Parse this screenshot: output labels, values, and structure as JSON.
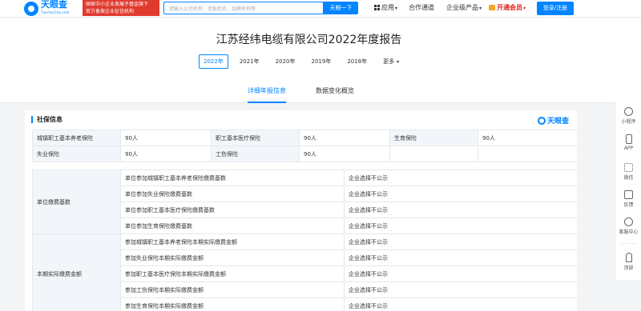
{
  "topbar": {
    "logo_text": "天眼查",
    "logo_sub": "TianYanCha.com",
    "promo_line1": "国家中小企业发展子基金旗下",
    "promo_line2": "官方备案企业征信机构",
    "search_placeholder": "请输入公司名称、老板姓名、品牌名称等",
    "search_button": "天眼一下",
    "nav_app": "应用",
    "nav_coop": "合作通道",
    "nav_products": "企业级产品",
    "nav_vip": "开通会员",
    "login_button": "登录/注册"
  },
  "header": {
    "title": "江苏经纬电缆有限公司2022年度报告",
    "years": [
      "2022年",
      "2021年",
      "2020年",
      "2019年",
      "2018年",
      "更多"
    ],
    "tabs": [
      "详细年报信息",
      "数据变化概览"
    ]
  },
  "section": {
    "title": "社保信息",
    "watermark": "天眼查"
  },
  "insurance": {
    "row1": [
      "城镇职工基本养老保险",
      "90人",
      "职工基本医疗保险",
      "90人",
      "生育保险",
      "90人"
    ],
    "row2": [
      "失业保险",
      "90人",
      "工伤保险",
      "90人"
    ]
  },
  "payment_base": {
    "label": "单位缴费基数",
    "items": [
      [
        "单位参加城镇职工基本养老保险缴费基数",
        "企业选择不公示"
      ],
      [
        "单位参加失业保险缴费基数",
        "企业选择不公示"
      ],
      [
        "单位参加职工基本医疗保险缴费基数",
        "企业选择不公示"
      ],
      [
        "单位参加生育保险缴费基数",
        "企业选择不公示"
      ]
    ]
  },
  "actual_payment": {
    "label": "本期实际缴费金额",
    "items": [
      [
        "参加城镇职工基本养老保险本期实际缴费金额",
        "企业选择不公示"
      ],
      [
        "参加失业保险本期实际缴费金额",
        "企业选择不公示"
      ],
      [
        "参加职工基本医疗保险本期实际缴费金额",
        "企业选择不公示"
      ],
      [
        "参加工伤保险本期实际缴费金额",
        "企业选择不公示"
      ],
      [
        "参加生育保险本期实际缴费金额",
        "企业选择不公示"
      ]
    ]
  },
  "sidebar": {
    "items": [
      "小程序",
      "APP",
      "微信",
      "反馈",
      "客服中心",
      "顶部"
    ]
  }
}
